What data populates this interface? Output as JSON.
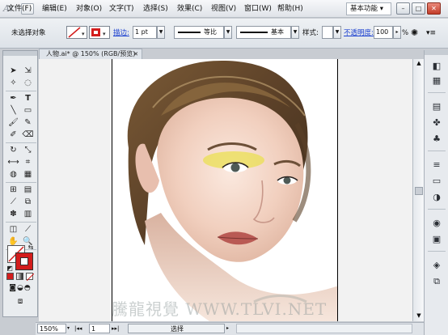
{
  "app": {
    "logo": "Ai"
  },
  "menu": [
    "文件(F)",
    "编辑(E)",
    "对象(O)",
    "文字(T)",
    "选择(S)",
    "效果(C)",
    "视图(V)",
    "窗口(W)",
    "帮助(H)"
  ],
  "workspace": {
    "label": "基本功能 ▾"
  },
  "window_controls": {
    "minimize": "–",
    "restore": "□",
    "close": "✕"
  },
  "control_bar": {
    "selection_status": "未选择对象",
    "stroke_label": "描边:",
    "stroke_weight": "1 pt",
    "profile_label": "等比",
    "brush_label": "基本",
    "style_label": "样式:",
    "opacity_label": "不透明度:",
    "opacity_value": "100",
    "percent": "%"
  },
  "document": {
    "tab_title": "人物.ai* @ 150% (RGB/预览)",
    "tab_close": "✕",
    "watermark": "騰龍視覺 WWW.TLVI.NET"
  },
  "status_bar": {
    "zoom": "150%",
    "page": "1",
    "tool_status": "选择"
  },
  "colors": {
    "fill": "#ffffff",
    "stroke": "#d31d1d",
    "accent_link": "#1a3fd0"
  }
}
